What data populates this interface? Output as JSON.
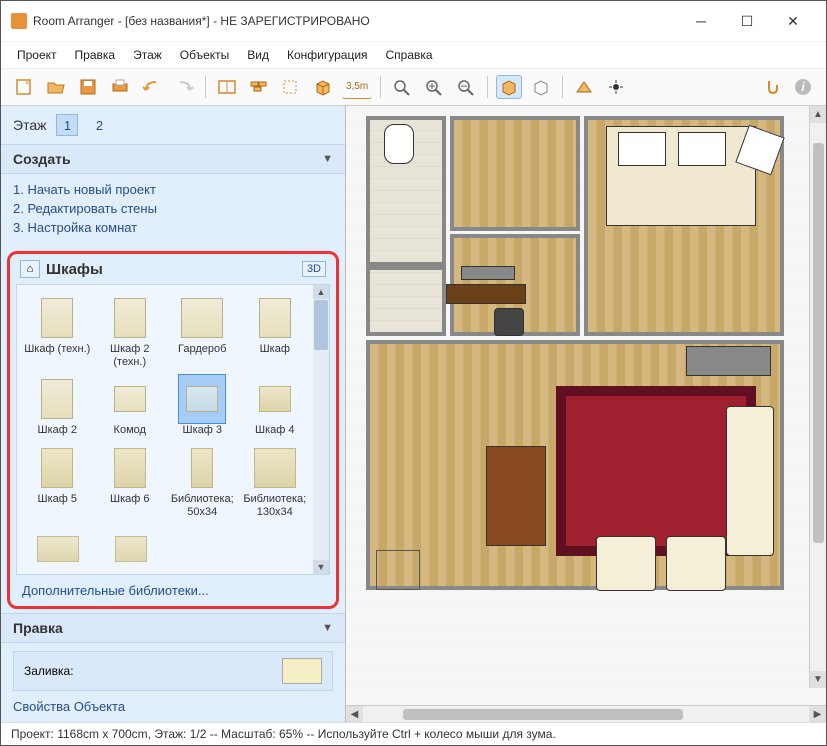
{
  "window": {
    "title": "Room Arranger - [без названия*] - НЕ ЗАРЕГИСТРИРОВАНО"
  },
  "menu": {
    "project": "Проект",
    "edit": "Правка",
    "floor": "Этаж",
    "objects": "Объекты",
    "view": "Вид",
    "config": "Конфигурация",
    "help": "Справка"
  },
  "toolbar": {
    "dim_label": "3,5m"
  },
  "sidebar": {
    "floor_label": "Этаж",
    "floor1": "1",
    "floor2": "2",
    "create_header": "Создать",
    "steps": {
      "s1": "1. Начать новый проект",
      "s2": "2. Редактировать стены",
      "s3": "3. Настройка комнат"
    },
    "library": {
      "title": "Шкафы",
      "btn3d": "3D",
      "more": "Дополнительные библиотеки...",
      "items": [
        {
          "name": "Шкаф (техн.)"
        },
        {
          "name": "Шкаф 2 (техн.)"
        },
        {
          "name": "Гардероб"
        },
        {
          "name": "Шкаф"
        },
        {
          "name": "Шкаф 2"
        },
        {
          "name": "Комод"
        },
        {
          "name": "Шкаф 3"
        },
        {
          "name": "Шкаф 4"
        },
        {
          "name": "Шкаф 5"
        },
        {
          "name": "Шкаф 6"
        },
        {
          "name": "Библиотека; 50x34"
        },
        {
          "name": "Библиотека; 130x34"
        }
      ]
    },
    "edit_header": "Правка",
    "fill_label": "Заливка:",
    "obj_props": "Свойства Объекта"
  },
  "status": {
    "text": "Проект: 1168cm x 700cm, Этаж: 1/2 -- Масштаб: 65% -- Используйте Ctrl + колесо мыши для зума."
  }
}
